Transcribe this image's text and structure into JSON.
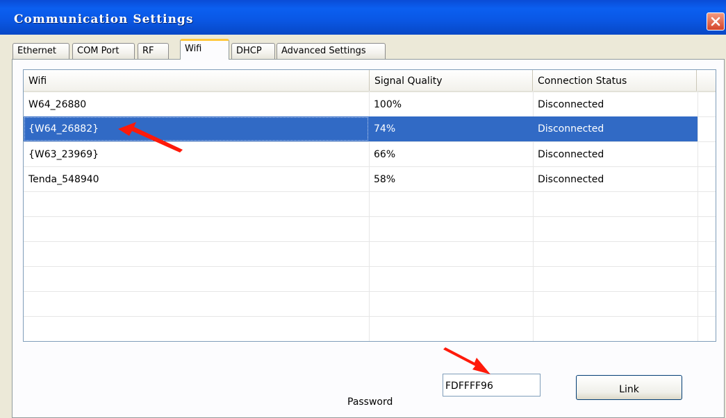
{
  "window": {
    "title": "Communication Settings",
    "close_icon": "close-icon"
  },
  "tabs": [
    {
      "label": "Ethernet",
      "active": false
    },
    {
      "label": "COM Port",
      "active": false
    },
    {
      "label": "RF",
      "active": false
    },
    {
      "label": "Wifi",
      "active": true
    },
    {
      "label": "DHCP",
      "active": false
    },
    {
      "label": "Advanced Settings",
      "active": false
    }
  ],
  "wifi_list": {
    "columns": [
      "Wifi",
      "Signal Quality",
      "Connection Status"
    ],
    "rows": [
      {
        "wifi": "W64_26880",
        "signal": "100%",
        "status": "Disconnected",
        "selected": false
      },
      {
        "wifi": "{W64_26882}",
        "signal": "74%",
        "status": "Disconnected",
        "selected": true
      },
      {
        "wifi": "{W63_23969}",
        "signal": "66%",
        "status": "Disconnected",
        "selected": false
      },
      {
        "wifi": "Tenda_548940",
        "signal": "58%",
        "status": "Disconnected",
        "selected": false
      }
    ]
  },
  "password": {
    "label": "Password",
    "value": "FDFFFF96"
  },
  "link_button": {
    "label": "Link"
  },
  "colors": {
    "title_bar": "#0a58e6",
    "selection": "#316ac5",
    "annotation_arrow": "#ff0000",
    "active_tab_highlight": "#ffc83c"
  }
}
